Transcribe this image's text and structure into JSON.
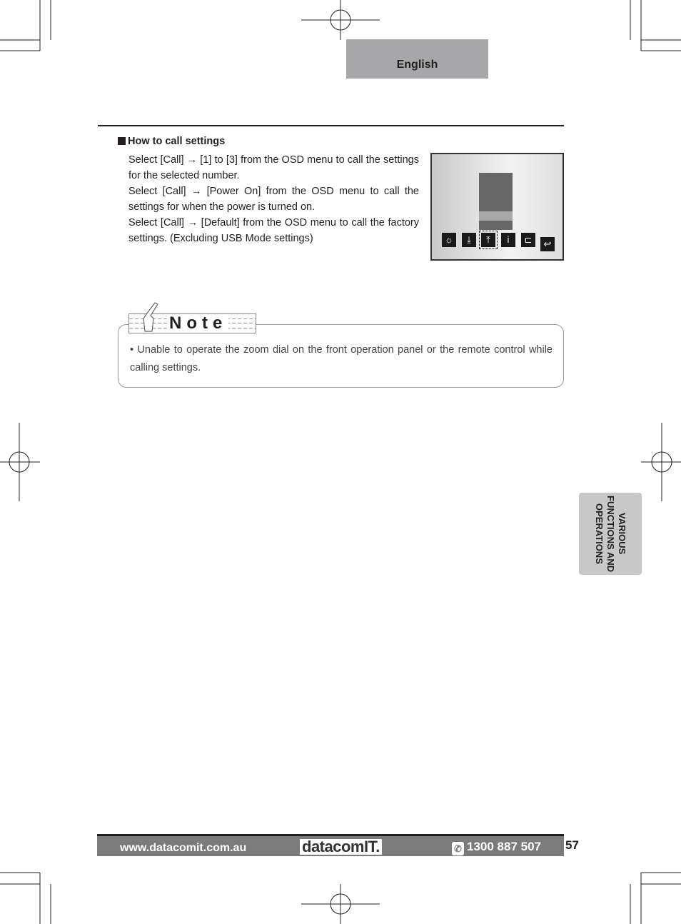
{
  "header": {
    "language_tab": "English"
  },
  "section": {
    "heading": "How to call settings",
    "paragraphs": [
      "Select [Call] → [1] to [3] from the OSD menu to call the settings for the selected number.",
      "Select [Call] → [Power On] from the OSD menu to call the settings for when the power is turned on.",
      "Select [Call] → [Default] from the OSD menu to call the factory settings. (Excluding USB Mode settings)"
    ],
    "osd_icons": [
      "brightness-settings-icon",
      "save-download-icon",
      "call-upload-icon",
      "info-icon",
      "usb-mode-icon",
      "return-icon"
    ]
  },
  "note": {
    "label": "Note",
    "items": [
      "Unable to operate the zoom dial on the front operation panel or the remote control while calling settings."
    ]
  },
  "side_tab": {
    "label": "VARIOUS FUNCTIONS AND OPERATIONS"
  },
  "footer": {
    "url": "www.datacomit.com.au",
    "logo": "datacomIT.",
    "phone": "1300 887 507",
    "page_number": "57"
  }
}
